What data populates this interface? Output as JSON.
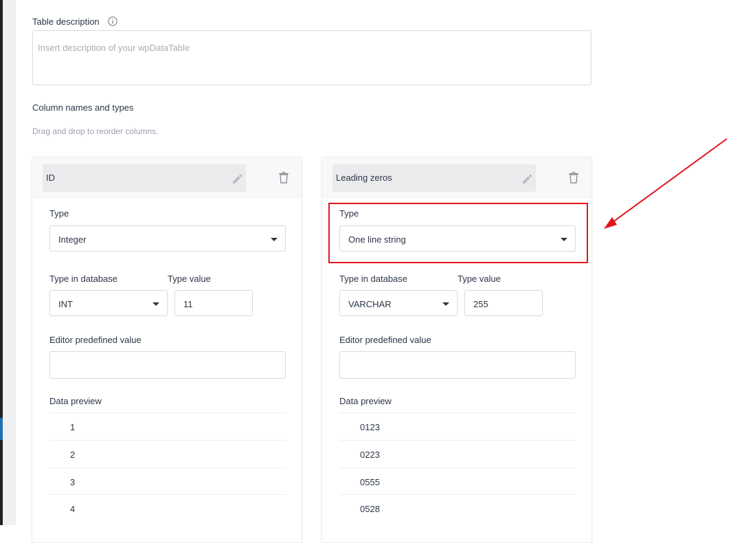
{
  "description": {
    "label": "Table description",
    "placeholder": "Insert description of your wpDataTable"
  },
  "columns_section": {
    "title": "Column names and types",
    "hint": "Drag and drop to reorder columns."
  },
  "labels": {
    "type": "Type",
    "type_in_db": "Type in database",
    "type_value": "Type value",
    "editor_predefined": "Editor predefined value",
    "data_preview": "Data preview"
  },
  "columns": [
    {
      "name": "ID",
      "type": "Integer",
      "db_type": "INT",
      "type_value": "11",
      "editor_value": "",
      "preview": [
        "1",
        "2",
        "3",
        "4"
      ]
    },
    {
      "name": "Leading zeros",
      "type": "One line string",
      "db_type": "VARCHAR",
      "type_value": "255",
      "editor_value": "",
      "preview": [
        "0123",
        "0223",
        "0555",
        "0528"
      ]
    }
  ],
  "icons": {
    "info": "info-icon",
    "edit": "pencil-icon",
    "delete": "trash-icon",
    "dropdown": "caret-down-icon",
    "annotation": "red-arrow"
  },
  "colors": {
    "highlight": "#e3141a",
    "text": "#2b3547",
    "muted": "#9aa0ab"
  }
}
